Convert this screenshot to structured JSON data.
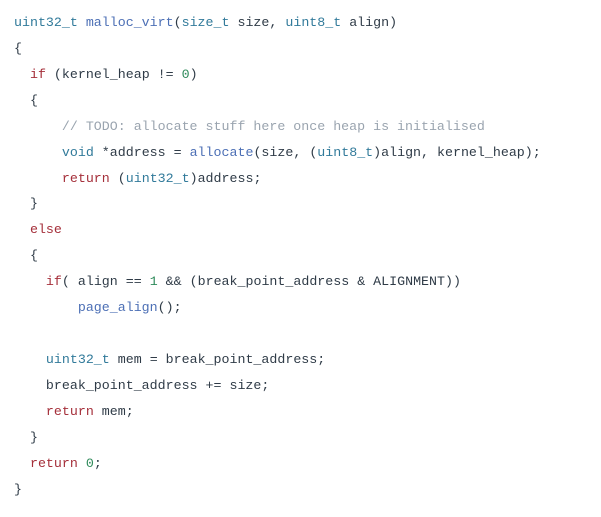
{
  "code": {
    "l1": {
      "t1": "uint32_t",
      "sp1": " ",
      "t2": "malloc_virt",
      "t3": "(",
      "t4": "size_t",
      "sp2": " ",
      "t5": "size",
      "t6": ",",
      "sp3": " ",
      "t7": "uint8_t",
      "sp4": " ",
      "t8": "align",
      "t9": ")"
    },
    "l2": {
      "t1": "{"
    },
    "l3": {
      "indent": "  ",
      "t1": "if",
      "sp1": " ",
      "t2": "(",
      "t3": "kernel_heap",
      "sp2": " ",
      "t4": "!=",
      "sp3": " ",
      "t5": "0",
      "t6": ")"
    },
    "l4": {
      "indent": "  ",
      "t1": "{"
    },
    "l5": {
      "indent": "      ",
      "t1": "// TODO: allocate stuff here once heap is initialised"
    },
    "l6": {
      "indent": "      ",
      "t1": "void",
      "sp1": " ",
      "t2": "*",
      "t3": "address",
      "sp2": " ",
      "t4": "=",
      "sp3": " ",
      "t5": "allocate",
      "t6": "(",
      "t7": "size",
      "t8": ",",
      "sp4": " ",
      "t9": "(",
      "t10": "uint8_t",
      "t11": ")",
      "t12": "align",
      "t13": ",",
      "sp5": " ",
      "t14": "kernel_heap",
      "t15": ")",
      "t16": ";"
    },
    "l7": {
      "indent": "      ",
      "t1": "return",
      "sp1": " ",
      "t2": "(",
      "t3": "uint32_t",
      "t4": ")",
      "t5": "address",
      "t6": ";"
    },
    "l8": {
      "indent": "  ",
      "t1": "}"
    },
    "l9": {
      "indent": "  ",
      "t1": "else"
    },
    "l10": {
      "indent": "  ",
      "t1": "{"
    },
    "l11": {
      "indent": "    ",
      "t1": "if",
      "t2": "(",
      "sp1": " ",
      "t3": "align",
      "sp2": " ",
      "t4": "==",
      "sp3": " ",
      "t5": "1",
      "sp4": " ",
      "t6": "&&",
      "sp5": " ",
      "t7": "(",
      "t8": "break_point_address",
      "sp6": " ",
      "t9": "&",
      "sp7": " ",
      "t10": "ALIGNMENT",
      "t11": ")",
      "t12": ")"
    },
    "l12": {
      "indent": "        ",
      "t1": "page_align",
      "t2": "(",
      "t3": ")",
      "t4": ";"
    },
    "l14": {
      "indent": "    ",
      "t1": "uint32_t",
      "sp1": " ",
      "t2": "mem",
      "sp2": " ",
      "t3": "=",
      "sp3": " ",
      "t4": "break_point_address",
      "t5": ";"
    },
    "l15": {
      "indent": "    ",
      "t1": "break_point_address",
      "sp1": " ",
      "t2": "+=",
      "sp2": " ",
      "t3": "size",
      "t4": ";"
    },
    "l16": {
      "indent": "    ",
      "t1": "return",
      "sp1": " ",
      "t2": "mem",
      "t3": ";"
    },
    "l17": {
      "indent": "  ",
      "t1": "}"
    },
    "l18": {
      "indent": "  ",
      "t1": "return",
      "sp1": " ",
      "t2": "0",
      "t3": ";"
    },
    "l19": {
      "t1": "}"
    }
  }
}
